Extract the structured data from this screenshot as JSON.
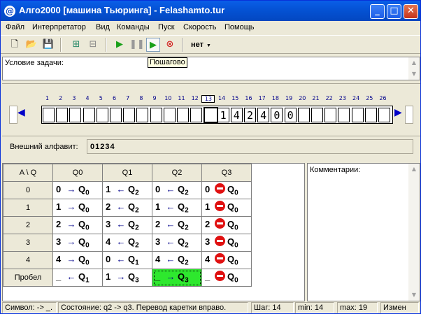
{
  "titlebar": {
    "title": "Алго2000 [машина Тьюринга] - Felashamto.tur",
    "icon": "@"
  },
  "menu": [
    "Файл",
    "Интерпретатор",
    "Вид",
    "Команды",
    "Пуск",
    "Скорость",
    "Помощь"
  ],
  "toolbar": {
    "speed_value": "нет",
    "tooltip": "Пошагово"
  },
  "task": {
    "label": "Условие задачи:"
  },
  "tape": {
    "numbers": [
      "1",
      "2",
      "3",
      "4",
      "5",
      "6",
      "7",
      "8",
      "9",
      "10",
      "11",
      "12",
      "13",
      "14",
      "15",
      "16",
      "17",
      "18",
      "19",
      "20",
      "21",
      "22",
      "23",
      "24",
      "25",
      "26"
    ],
    "current_index": 13,
    "cells": [
      "",
      "",
      "",
      "",
      "",
      "",
      "",
      "",
      "",
      "",
      "",
      "",
      "",
      "1",
      "4",
      "2",
      "4",
      "0",
      "0",
      "",
      "",
      "",
      "",
      "",
      "",
      ""
    ]
  },
  "alphabet": {
    "label": "Внешний алфавит:",
    "value": "01234"
  },
  "program": {
    "corner": "A \\ Q",
    "states": [
      "Q0",
      "Q1",
      "Q2",
      "Q3"
    ],
    "rows": [
      {
        "symbol": "0",
        "cells": [
          {
            "sym": "0",
            "dir": "→",
            "state": "Q",
            "sub": "0"
          },
          {
            "sym": "1",
            "dir": "←",
            "state": "Q",
            "sub": "2"
          },
          {
            "sym": "0",
            "dir": "←",
            "state": "Q",
            "sub": "2"
          },
          {
            "sym": "0",
            "dir": "stop",
            "state": "Q",
            "sub": "0"
          }
        ]
      },
      {
        "symbol": "1",
        "cells": [
          {
            "sym": "1",
            "dir": "→",
            "state": "Q",
            "sub": "0"
          },
          {
            "sym": "2",
            "dir": "←",
            "state": "Q",
            "sub": "2"
          },
          {
            "sym": "1",
            "dir": "←",
            "state": "Q",
            "sub": "2"
          },
          {
            "sym": "1",
            "dir": "stop",
            "state": "Q",
            "sub": "0"
          }
        ]
      },
      {
        "symbol": "2",
        "cells": [
          {
            "sym": "2",
            "dir": "→",
            "state": "Q",
            "sub": "0"
          },
          {
            "sym": "3",
            "dir": "←",
            "state": "Q",
            "sub": "2"
          },
          {
            "sym": "2",
            "dir": "←",
            "state": "Q",
            "sub": "2"
          },
          {
            "sym": "2",
            "dir": "stop",
            "state": "Q",
            "sub": "0"
          }
        ]
      },
      {
        "symbol": "3",
        "cells": [
          {
            "sym": "3",
            "dir": "→",
            "state": "Q",
            "sub": "0"
          },
          {
            "sym": "4",
            "dir": "←",
            "state": "Q",
            "sub": "2"
          },
          {
            "sym": "3",
            "dir": "←",
            "state": "Q",
            "sub": "2"
          },
          {
            "sym": "3",
            "dir": "stop",
            "state": "Q",
            "sub": "0"
          }
        ]
      },
      {
        "symbol": "4",
        "cells": [
          {
            "sym": "4",
            "dir": "→",
            "state": "Q",
            "sub": "0"
          },
          {
            "sym": "0",
            "dir": "←",
            "state": "Q",
            "sub": "1"
          },
          {
            "sym": "4",
            "dir": "←",
            "state": "Q",
            "sub": "2"
          },
          {
            "sym": "4",
            "dir": "stop",
            "state": "Q",
            "sub": "0"
          }
        ]
      },
      {
        "symbol": "Пробел",
        "cells": [
          {
            "sym": "_",
            "dir": "←",
            "state": "Q",
            "sub": "1"
          },
          {
            "sym": "1",
            "dir": "→",
            "state": "Q",
            "sub": "3"
          },
          {
            "sym": "_",
            "dir": "→",
            "state": "Q",
            "sub": "3",
            "highlight": true
          },
          {
            "sym": "_",
            "dir": "stop",
            "state": "Q",
            "sub": "0"
          }
        ]
      }
    ],
    "highlight_color": "#2ee82e"
  },
  "comments": {
    "label": "Комментарии:"
  },
  "status": {
    "symbol": "Символ:  -> _.",
    "state": "Состояние: q2 -> q3.  Перевод каретки вправо.",
    "step": "Шаг:   14",
    "min": "min: 14",
    "max": "max: 19",
    "mode": "Измен"
  }
}
